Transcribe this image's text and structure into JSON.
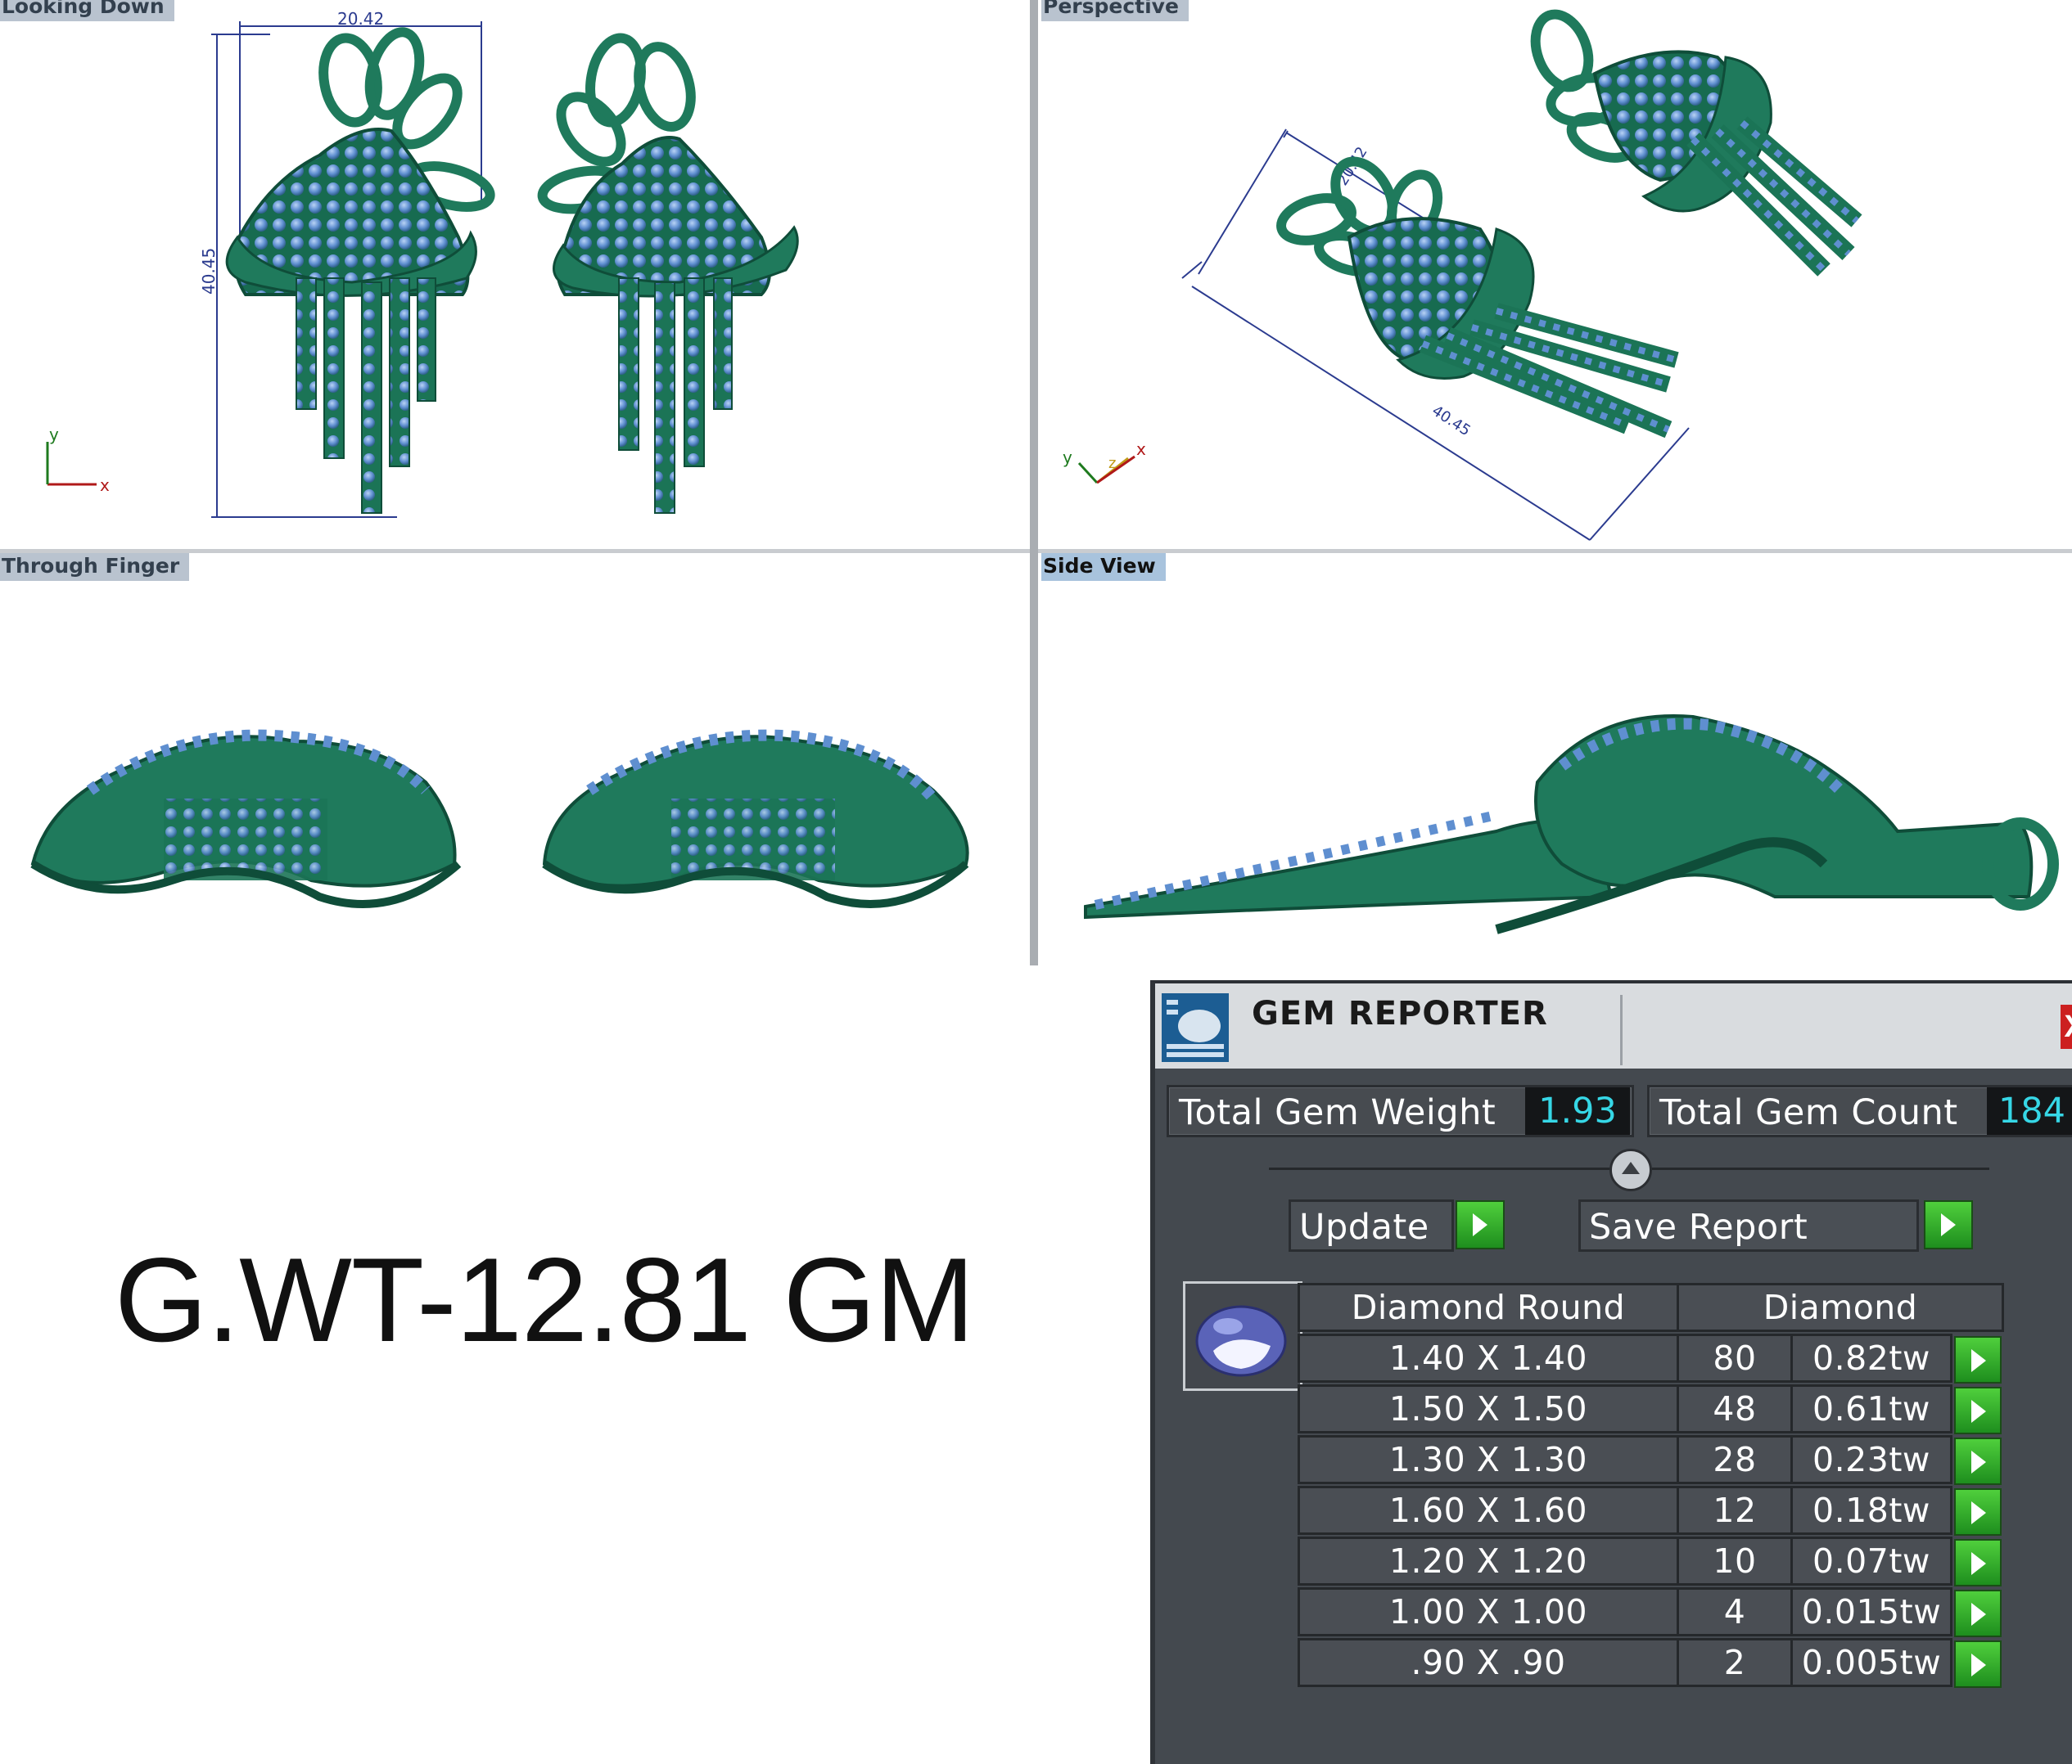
{
  "viewports": {
    "top_left": {
      "label": "Looking Down",
      "dim_width": "20.42",
      "dim_height": "40.45",
      "axis_y": "y",
      "axis_x": "x"
    },
    "top_right": {
      "label": "Perspective",
      "dim_width": "20.42",
      "dim_length": "40.45",
      "axis_y": "y",
      "axis_z": "z",
      "axis_x": "x"
    },
    "bottom_left": {
      "label": "Through Finger"
    },
    "bottom_right": {
      "label": "Side View"
    }
  },
  "gross_weight": "G.WT-12.81 GM",
  "gem_reporter": {
    "title": "GEM REPORTER",
    "close_label": "X",
    "total_weight_label": "Total Gem Weight",
    "total_weight_value": "1.93",
    "total_count_label": "Total Gem Count",
    "total_count_value": "184",
    "update_label": "Update",
    "save_report_label": "Save Report",
    "table": {
      "header_shape": "Diamond Round",
      "header_material": "Diamond",
      "rows": [
        {
          "size": "1.40 X 1.40",
          "count": "80",
          "weight": "0.82tw"
        },
        {
          "size": "1.50 X 1.50",
          "count": "48",
          "weight": "0.61tw"
        },
        {
          "size": "1.30 X 1.30",
          "count": "28",
          "weight": "0.23tw"
        },
        {
          "size": "1.60 X 1.60",
          "count": "12",
          "weight": "0.18tw"
        },
        {
          "size": "1.20 X 1.20",
          "count": "10",
          "weight": "0.07tw"
        },
        {
          "size": "1.00 X 1.00",
          "count": "4",
          "weight": "0.015tw"
        },
        {
          "size": ".90 X .90",
          "count": "2",
          "weight": "0.005tw"
        }
      ]
    }
  },
  "colors": {
    "metal": "#1f7a5c",
    "metal_dark": "#0f4d39",
    "gem": "#5f8fd0",
    "panel": "#44494f",
    "value_text": "#36d7e6"
  }
}
